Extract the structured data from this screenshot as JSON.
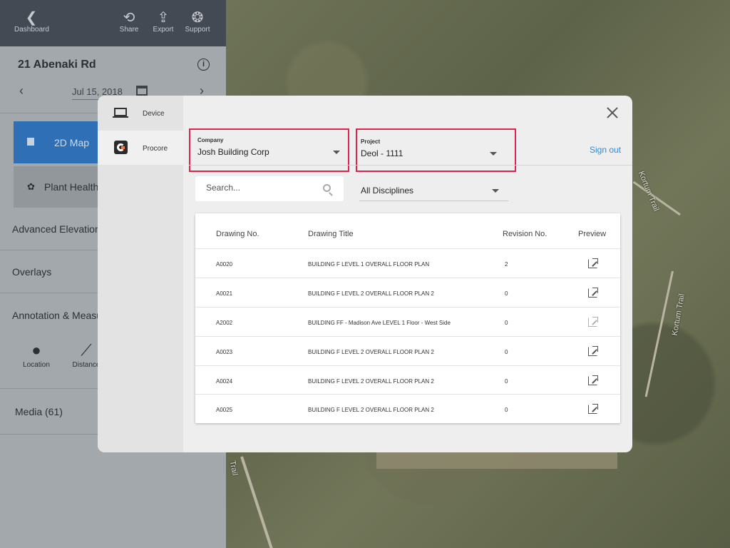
{
  "topbar": {
    "dashboard_label": "Dashboard",
    "share_label": "Share",
    "export_label": "Export",
    "support_label": "Support"
  },
  "site": {
    "title": "21 Abenaki Rd",
    "date": "Jul 15, 2018"
  },
  "sidebar": {
    "map2d_label": "2D Map",
    "plant_label": "Plant Health",
    "sections": [
      "Advanced Elevation",
      "Overlays",
      "Annotation & Measu",
      "Media (61)"
    ],
    "tools": [
      "Location",
      "Distance"
    ]
  },
  "map_labels": [
    "Kortum Trail",
    "Kortum Trail",
    "Trail"
  ],
  "modal": {
    "sources": [
      "Device",
      "Procore"
    ],
    "company": {
      "caption": "Company",
      "value": "Josh Building Corp"
    },
    "project": {
      "caption": "Project",
      "value": "Deol - 1111"
    },
    "signout_label": "Sign out",
    "search": {
      "placeholder": "Search..."
    },
    "disciplines": {
      "value": "All Disciplines"
    },
    "table": {
      "headers": [
        "Drawing No.",
        "Drawing Title",
        "Revision No.",
        "Preview"
      ],
      "rows": [
        {
          "no": "A0020",
          "title": "BUILDING F LEVEL 1 OVERALL FLOOR PLAN",
          "rev": "2"
        },
        {
          "no": "A0021",
          "title": "BUILDING F LEVEL 2 OVERALL FLOOR PLAN 2",
          "rev": "0"
        },
        {
          "no": "A2002",
          "title": "BUILDING FF - Madison Ave LEVEL 1 Floor - West Side",
          "rev": "0"
        },
        {
          "no": "A0023",
          "title": "BUILDING F LEVEL 2 OVERALL FLOOR PLAN 2",
          "rev": "0"
        },
        {
          "no": "A0024",
          "title": "BUILDING F LEVEL 2 OVERALL FLOOR PLAN 2",
          "rev": "0"
        },
        {
          "no": "A0025",
          "title": "BUILDING F LEVEL 2 OVERALL FLOOR PLAN 2",
          "rev": "0"
        }
      ]
    }
  },
  "colors": {
    "highlight": "#e0234d",
    "link": "#2a8ae6",
    "primary": "#2e6fb5"
  }
}
